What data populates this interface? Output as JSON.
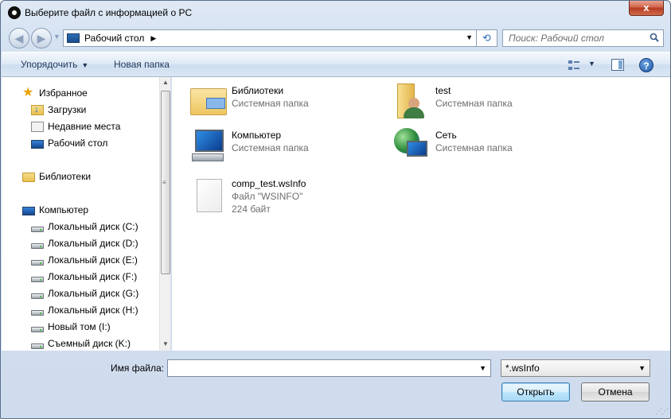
{
  "window": {
    "title": "Выберите файл с информацией о PC",
    "close_label": "x"
  },
  "address": {
    "location": "Рабочий стол",
    "refresh_glyph": "⟲"
  },
  "search": {
    "placeholder": "Поиск: Рабочий стол"
  },
  "toolbar": {
    "organize_label": "Упорядочить",
    "new_folder_label": "Новая папка",
    "help_glyph": "?"
  },
  "sidebar": {
    "favorites": "Избранное",
    "downloads": "Загрузки",
    "recent": "Недавние места",
    "desktop": "Рабочий стол",
    "libraries": "Библиотеки",
    "computer": "Компьютер",
    "drives": [
      "Локальный диск (C:)",
      "Локальный диск (D:)",
      "Локальный диск (E:)",
      "Локальный диск (F:)",
      "Локальный диск (G:)",
      "Локальный диск (H:)",
      "Новый том (I:)",
      "Съемный диск (K:)"
    ]
  },
  "items": [
    {
      "name": "Библиотеки",
      "type": "Системная папка",
      "icon": "library-icon"
    },
    {
      "name": "test",
      "type": "Системная папка",
      "icon": "user-folder-icon"
    },
    {
      "name": "Компьютер",
      "type": "Системная папка",
      "icon": "computer-icon"
    },
    {
      "name": "Сеть",
      "type": "Системная папка",
      "icon": "network-icon"
    },
    {
      "name": "comp_test.wsInfo",
      "type": "Файл \"WSINFO\"",
      "size": "224 байт",
      "icon": "document-icon"
    }
  ],
  "bottom": {
    "filename_label": "Имя файла:",
    "filename_value": "",
    "filter": "*.wsInfo",
    "open_label": "Открыть",
    "cancel_label": "Отмена"
  }
}
